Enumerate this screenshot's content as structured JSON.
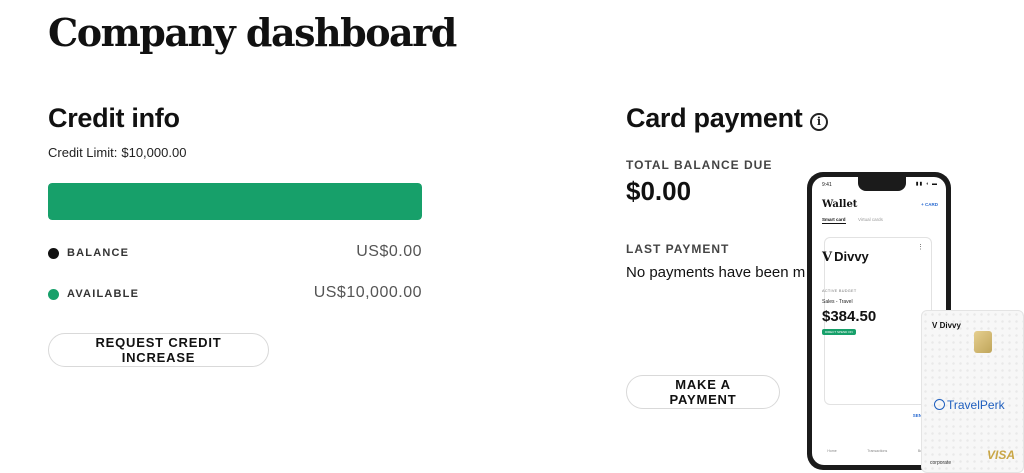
{
  "page": {
    "title": "Company dashboard"
  },
  "credit": {
    "title": "Credit info",
    "limit_label": "Credit Limit:",
    "limit_value": "$10,000.00",
    "bar_fill_fraction": 1.0,
    "bar_color": "#17a06a",
    "balance_label": "BALANCE",
    "balance_value": "US$0.00",
    "balance_color": "#111111",
    "available_label": "AVAILABLE",
    "available_value": "US$10,000.00",
    "available_color": "#17a06a",
    "request_button_label": "REQUEST CREDIT INCREASE"
  },
  "card_payment": {
    "title": "Card payment",
    "info_icon": "info-icon",
    "total_label": "TOTAL BALANCE DUE",
    "total_value": "$0.00",
    "last_label": "LAST PAYMENT",
    "last_text": "No payments have been m yet.",
    "make_payment_label": "MAKE A PAYMENT"
  },
  "phone": {
    "time": "9:41",
    "wallet_title": "Wallet",
    "add_card": "+ CARD",
    "tab_smart": "Smart card",
    "tab_virtual": "Virtual cards",
    "brand": "Divvy",
    "active_budget": "ACTIVE BUDGET",
    "budget_name": "Sales - Travel",
    "amount": "$384.50",
    "badge": "DIRECT SPEND ON",
    "send_funds": "SEND FUNDS",
    "nav": [
      "Home",
      "Transactions",
      "Budgets"
    ]
  },
  "corporate_card": {
    "brand": "Divvy",
    "partner": "TravelPerk",
    "type": "corporate",
    "network": "VISA"
  }
}
